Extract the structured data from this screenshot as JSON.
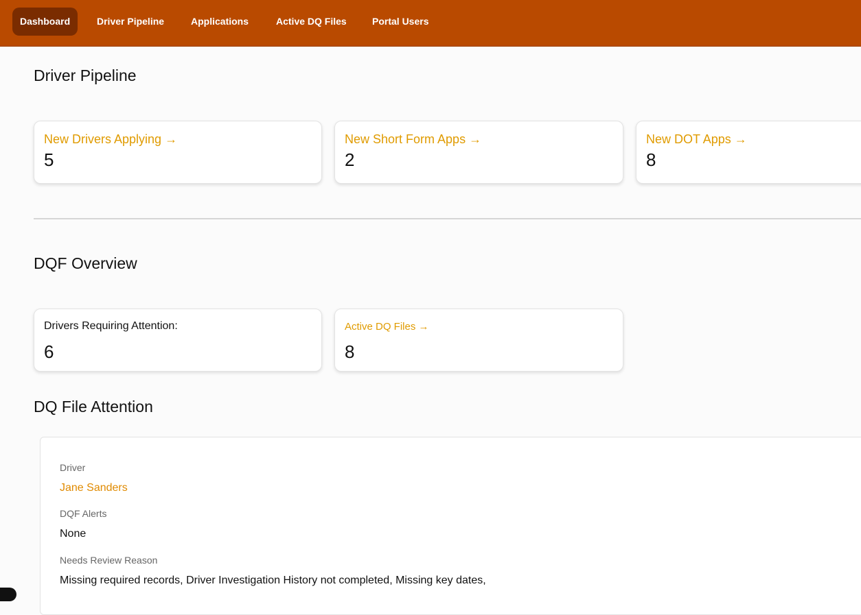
{
  "nav": {
    "items": [
      {
        "label": "Dashboard",
        "active": true
      },
      {
        "label": "Driver Pipeline"
      },
      {
        "label": "Applications"
      },
      {
        "label": "Active DQ Files"
      },
      {
        "label": "Portal Users"
      }
    ]
  },
  "driver_pipeline": {
    "title": "Driver Pipeline",
    "cards": [
      {
        "label": "New Drivers Applying →",
        "value": "5"
      },
      {
        "label": "New Short Form Apps →",
        "value": "2"
      },
      {
        "label": "New DOT Apps →",
        "value": "8"
      }
    ]
  },
  "dqf_overview": {
    "title": "DQF Overview",
    "cards": [
      {
        "label": "Drivers Requiring Attention:",
        "value": "6"
      },
      {
        "label": "Active DQ Files →",
        "value": "8"
      }
    ]
  },
  "dq_file_attention": {
    "title": "DQ File Attention",
    "driver_label": "Driver",
    "driver_value": "Jane Sanders",
    "alerts_label": "DQF Alerts",
    "alerts_value": "None",
    "reason_label": "Needs Review Reason",
    "reason_value": "Missing required records, Driver Investigation History not completed, Missing key dates,"
  },
  "colors": {
    "nav_background": "#b94a00",
    "nav_active": "#7a2c00",
    "link_accent": "#e09b00"
  }
}
